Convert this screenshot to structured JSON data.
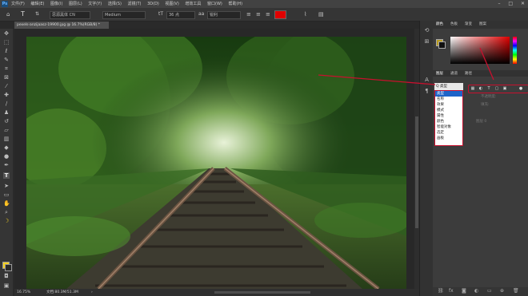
{
  "menubar": {
    "logo": "Ps",
    "items": [
      "文件(F)",
      "编辑(E)",
      "图像(I)",
      "图层(L)",
      "文字(Y)",
      "选择(S)",
      "滤镜(T)",
      "3D(D)",
      "视图(V)",
      "增效工具",
      "窗口(W)",
      "帮助(H)"
    ],
    "window_controls": {
      "minimize": "–",
      "maximize": "□",
      "close": "✕"
    }
  },
  "options_bar": {
    "font_family": "思源黑体 CN",
    "font_style": "Medium",
    "font_size": "36 点",
    "antialias": "锐利",
    "text_color": "#e00000"
  },
  "document": {
    "tab_title": "pexels-anzijaasz-19900.jpg @ 16.7%(RGB/8) *",
    "close": "×"
  },
  "status_bar": {
    "zoom": "16.75%",
    "doc_size": "文档:80.3M/51.3M",
    "arrow": "›"
  },
  "tools": [
    "move",
    "marquee",
    "lasso",
    "quick-select",
    "crop",
    "frame",
    "eyedropper",
    "healing",
    "brush",
    "clone",
    "history-brush",
    "eraser",
    "gradient",
    "blur",
    "dodge",
    "pen",
    "type",
    "path-select",
    "rectangle",
    "hand",
    "zoom",
    "more"
  ],
  "panels": {
    "color_tabs": [
      "颜色",
      "色板",
      "渐变",
      "图案"
    ],
    "layers_tabs": [
      "图层",
      "通道",
      "路径"
    ],
    "layer_kind_selected": "Q 类型",
    "kind_options": [
      "类型",
      "名称",
      "效果",
      "模式",
      "属性",
      "颜色",
      "智能对象",
      "选定",
      "画板"
    ],
    "opacity_label": "不透明度:",
    "fill_label": "填充:",
    "layer_name": "图层 0"
  },
  "colors": {
    "foreground": "#f5d020",
    "annotation": "#c8102e",
    "picker_hue": "#e00000"
  }
}
